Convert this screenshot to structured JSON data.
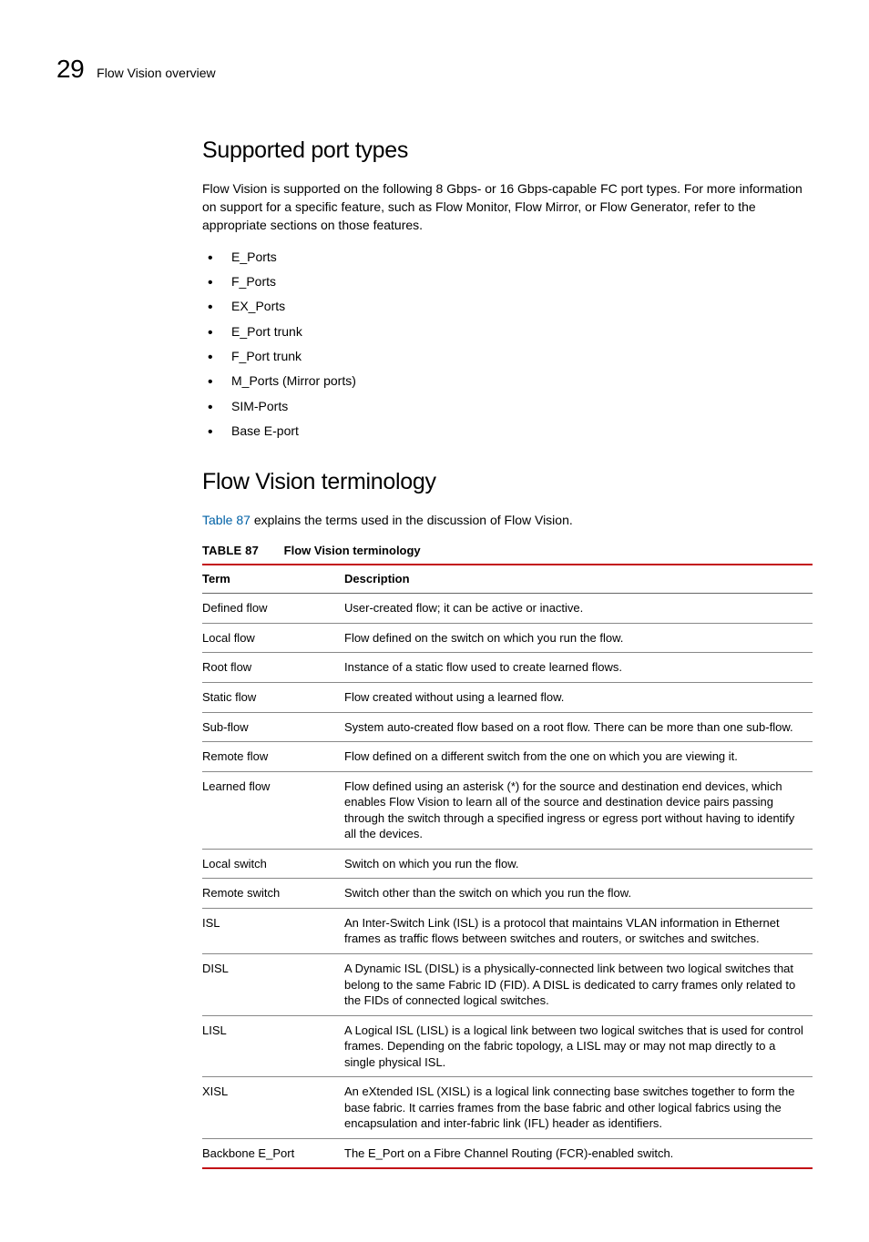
{
  "header": {
    "chapter_number": "29",
    "running_title": "Flow Vision overview"
  },
  "section1": {
    "heading": "Supported port types",
    "intro": "Flow Vision is supported on the following 8 Gbps- or 16 Gbps-capable FC port types. For more information on support for a specific feature, such as Flow Monitor, Flow Mirror, or Flow Generator, refer to the appropriate sections on those features.",
    "items": [
      "E_Ports",
      "F_Ports",
      "EX_Ports",
      "E_Port trunk",
      "F_Port trunk",
      "M_Ports (Mirror ports)",
      "SIM-Ports",
      "Base E-port"
    ]
  },
  "section2": {
    "heading": "Flow Vision terminology",
    "intro_link": "Table 87",
    "intro_rest": " explains the terms used in the discussion of Flow Vision.",
    "table_label": "TABLE 87",
    "table_title": "Flow Vision terminology",
    "col_term": "Term",
    "col_desc": "Description",
    "rows": [
      {
        "term": "Defined flow",
        "desc": "User-created flow; it can be active or inactive."
      },
      {
        "term": "Local flow",
        "desc": "Flow defined on the switch on which you run the flow."
      },
      {
        "term": "Root flow",
        "desc": "Instance of a static flow used to create learned flows."
      },
      {
        "term": "Static flow",
        "desc": "Flow created without using a learned flow."
      },
      {
        "term": "Sub-flow",
        "desc": "System auto-created flow based on a root flow. There can be more than one sub-flow."
      },
      {
        "term": "Remote flow",
        "desc": "Flow defined on a different switch from the one on which you are viewing it."
      },
      {
        "term": "Learned flow",
        "desc": "Flow defined using an asterisk (*) for the source and destination end devices, which enables Flow Vision to learn all of the source and destination device pairs passing through the switch through a specified ingress or egress port without having to identify all the devices."
      },
      {
        "term": "Local switch",
        "desc": "Switch on which you run the flow."
      },
      {
        "term": "Remote switch",
        "desc": "Switch other than the switch on which you run the flow."
      },
      {
        "term": "ISL",
        "desc": "An Inter-Switch Link (ISL) is a protocol that maintains VLAN information in Ethernet frames as traffic flows between switches and routers, or switches and switches."
      },
      {
        "term": "DISL",
        "desc": "A Dynamic ISL (DISL) is a physically-connected link between two logical switches that belong to the same Fabric ID (FID). A DISL is dedicated to carry frames only related to the FIDs of connected logical switches."
      },
      {
        "term": "LISL",
        "desc": "A Logical ISL (LISL) is a logical link between two logical switches that is used for control frames. Depending on the fabric topology, a LISL may or may not map directly to a single physical ISL."
      },
      {
        "term": "XISL",
        "desc": "An eXtended ISL (XISL) is a logical link connecting base switches together to form the base fabric. It carries frames from the base fabric and other logical fabrics using the encapsulation and inter-fabric link (IFL) header as identifiers."
      },
      {
        "term": "Backbone E_Port",
        "desc": "The E_Port on a Fibre Channel Routing (FCR)-enabled switch."
      }
    ]
  }
}
